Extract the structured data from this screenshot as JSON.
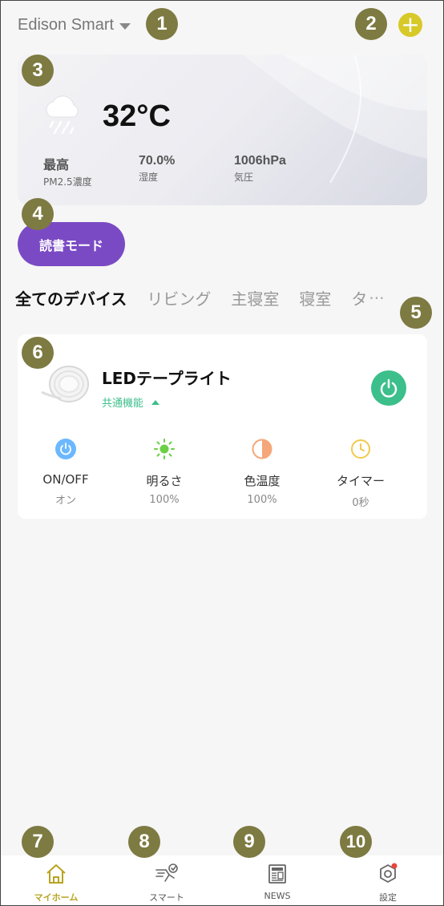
{
  "header": {
    "title": "Edison Smart"
  },
  "weather": {
    "temperature": "32°C",
    "stats": [
      {
        "value": "最高",
        "label": "PM2.5濃度"
      },
      {
        "value": "70.0%",
        "label": "湿度"
      },
      {
        "value": "1006hPa",
        "label": "気圧"
      }
    ]
  },
  "scene": {
    "label": "読書モード"
  },
  "tabs": [
    {
      "label": "全てのデバイス"
    },
    {
      "label": "リビング"
    },
    {
      "label": "主寝室"
    },
    {
      "label": "寝室"
    },
    {
      "label": "タ"
    }
  ],
  "tabs_more": "···",
  "device": {
    "name": "LEDテープライト",
    "subtitle": "共通機能",
    "functions": [
      {
        "name": "ON/OFF",
        "value": "オン",
        "icon": "power-icon",
        "color": "#6cb8ff"
      },
      {
        "name": "明るさ",
        "value": "100%",
        "icon": "brightness-icon",
        "color": "#6bd045"
      },
      {
        "name": "色温度",
        "value": "100%",
        "icon": "color-temperature-icon",
        "color": "#f5a77a"
      },
      {
        "name": "タイマー",
        "value": "0秒",
        "icon": "timer-icon",
        "color": "#f2c94c"
      }
    ]
  },
  "nav": [
    {
      "label": "マイホーム",
      "icon": "home-icon",
      "active": true
    },
    {
      "label": "スマート",
      "icon": "smart-icon",
      "active": false
    },
    {
      "label": "NEWS",
      "icon": "news-icon",
      "active": false
    },
    {
      "label": "設定",
      "icon": "settings-icon",
      "active": false
    }
  ],
  "markers": [
    "1",
    "2",
    "3",
    "4",
    "5",
    "6",
    "7",
    "8",
    "9",
    "10"
  ],
  "colors": {
    "accent": "#d7c928",
    "scene": "#7a4ac4",
    "power": "#3cbf8a",
    "marker": "#7d7a42"
  }
}
